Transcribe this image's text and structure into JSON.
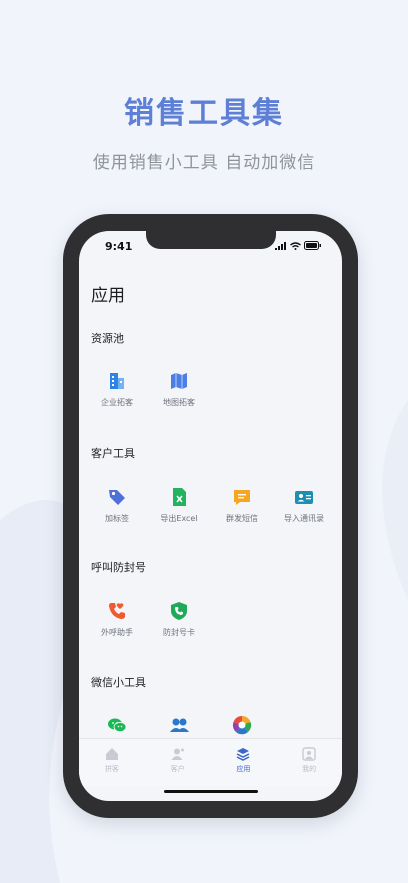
{
  "headline": "销售工具集",
  "subline": "使用销售小工具  自动加微信",
  "status": {
    "time": "9:41"
  },
  "page_title": "应用",
  "sections": [
    {
      "title": "资源池",
      "items": [
        {
          "label": "企业拓客",
          "icon": "building-icon"
        },
        {
          "label": "地图拓客",
          "icon": "map-icon"
        }
      ]
    },
    {
      "title": "客户工具",
      "items": [
        {
          "label": "加标签",
          "icon": "tag-icon"
        },
        {
          "label": "导出Excel",
          "icon": "excel-icon"
        },
        {
          "label": "群发短信",
          "icon": "sms-icon"
        },
        {
          "label": "导入通讯录",
          "icon": "contact-card-icon"
        }
      ]
    },
    {
      "title": "呼叫防封号",
      "items": [
        {
          "label": "外呼助手",
          "icon": "phone-heart-icon"
        },
        {
          "label": "防封号卡",
          "icon": "shield-phone-icon"
        }
      ]
    },
    {
      "title": "微信小工具",
      "items": [
        {
          "label": "",
          "icon": "wechat-icon"
        },
        {
          "label": "",
          "icon": "users-icon"
        },
        {
          "label": "",
          "icon": "aperture-icon"
        }
      ]
    }
  ],
  "tabbar": [
    {
      "label": "拼客",
      "icon": "home-icon",
      "active": false
    },
    {
      "label": "客户",
      "icon": "customer-icon",
      "active": false
    },
    {
      "label": "应用",
      "icon": "layers-icon",
      "active": true
    },
    {
      "label": "我的",
      "icon": "profile-icon",
      "active": false
    }
  ],
  "colors": {
    "accent": "#3c66c9",
    "headline": "#5e7fd6"
  }
}
